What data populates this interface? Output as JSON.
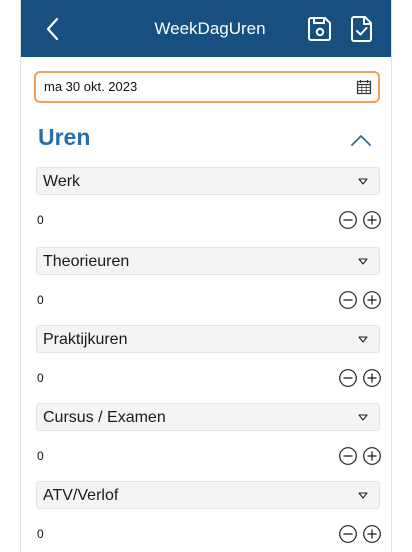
{
  "header": {
    "title": "WeekDagUren",
    "back_icon": "chevron-left-icon",
    "save_icon": "floppy-disk-icon",
    "document_icon": "document-check-icon",
    "bar_color": "#164f80"
  },
  "date_field": {
    "value": "ma 30 okt. 2023",
    "icon": "calendar-icon",
    "border_color": "#f0a05a"
  },
  "section": {
    "title": "Uren",
    "title_color": "#2b6ea8",
    "collapse_icon": "chevron-up-icon"
  },
  "rows": [
    {
      "category": "Werk",
      "value": "0"
    },
    {
      "category": "Theorieuren",
      "value": "0"
    },
    {
      "category": "Praktijkuren",
      "value": "0"
    },
    {
      "category": "Cursus / Examen",
      "value": "0"
    },
    {
      "category": "ATV/Verlof",
      "value": "0"
    }
  ]
}
